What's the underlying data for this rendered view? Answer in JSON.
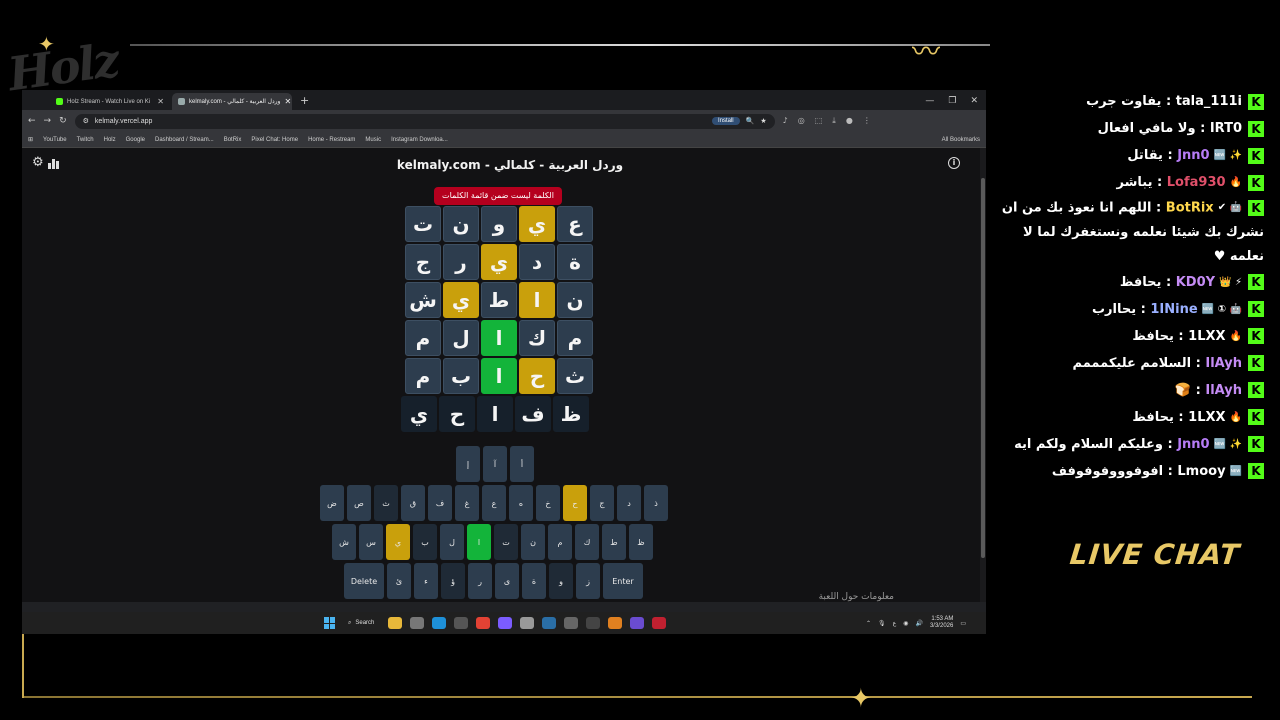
{
  "browser": {
    "tabs": [
      {
        "label": "Holz Stream - Watch Live on Ki"
      },
      {
        "label": "kelmaly.com - وردل العربية - كلمالي"
      }
    ],
    "url": "kelmaly.vercel.app",
    "install_label": "Install",
    "bookmarks": [
      "YouTube",
      "Twitch",
      "Holz",
      "Google",
      "Dashboard / Stream...",
      "BotRix",
      "Pixel Chat: Home",
      "Home - Restream",
      "Music",
      "Instagram Downloa..."
    ],
    "all_bookmarks": "All Bookmarks"
  },
  "game": {
    "title": "kelmaly.com - وردل العربية - كلمالي",
    "toast": "الكلمة ليست ضمن قائمة الكلمات",
    "board": [
      [
        {
          "l": "ت",
          "s": ""
        },
        {
          "l": "ن",
          "s": ""
        },
        {
          "l": "و",
          "s": ""
        },
        {
          "l": "ي",
          "s": "y"
        },
        {
          "l": "ع",
          "s": ""
        }
      ],
      [
        {
          "l": "ج",
          "s": ""
        },
        {
          "l": "ر",
          "s": ""
        },
        {
          "l": "ي",
          "s": "y"
        },
        {
          "l": "د",
          "s": ""
        },
        {
          "l": "ة",
          "s": ""
        }
      ],
      [
        {
          "l": "ش",
          "s": ""
        },
        {
          "l": "ي",
          "s": "y"
        },
        {
          "l": "ط",
          "s": ""
        },
        {
          "l": "ا",
          "s": "y"
        },
        {
          "l": "ن",
          "s": ""
        }
      ],
      [
        {
          "l": "م",
          "s": ""
        },
        {
          "l": "ل",
          "s": ""
        },
        {
          "l": "ا",
          "s": "g"
        },
        {
          "l": "ك",
          "s": ""
        },
        {
          "l": "م",
          "s": ""
        }
      ],
      [
        {
          "l": "م",
          "s": ""
        },
        {
          "l": "ب",
          "s": ""
        },
        {
          "l": "ا",
          "s": "g"
        },
        {
          "l": "ح",
          "s": "y"
        },
        {
          "l": "ث",
          "s": ""
        }
      ],
      [
        {
          "l": "ي",
          "s": "e"
        },
        {
          "l": "ح",
          "s": "e"
        },
        {
          "l": "ا",
          "s": "e"
        },
        {
          "l": "ف",
          "s": "e"
        },
        {
          "l": "ظ",
          "s": "e"
        }
      ]
    ],
    "keyboard": [
      [
        {
          "l": "إ",
          "s": ""
        },
        {
          "l": "آ",
          "s": ""
        },
        {
          "l": "أ",
          "s": ""
        }
      ],
      [
        {
          "l": "ض",
          "s": ""
        },
        {
          "l": "ص",
          "s": ""
        },
        {
          "l": "ث",
          "s": "d"
        },
        {
          "l": "ق",
          "s": ""
        },
        {
          "l": "ف",
          "s": ""
        },
        {
          "l": "غ",
          "s": ""
        },
        {
          "l": "ع",
          "s": ""
        },
        {
          "l": "ه",
          "s": ""
        },
        {
          "l": "خ",
          "s": ""
        },
        {
          "l": "ح",
          "s": "y"
        },
        {
          "l": "ج",
          "s": ""
        },
        {
          "l": "د",
          "s": ""
        },
        {
          "l": "ذ",
          "s": ""
        }
      ],
      [
        {
          "l": "ش",
          "s": ""
        },
        {
          "l": "س",
          "s": ""
        },
        {
          "l": "ي",
          "s": "y"
        },
        {
          "l": "ب",
          "s": "d"
        },
        {
          "l": "ل",
          "s": ""
        },
        {
          "l": "ا",
          "s": "g"
        },
        {
          "l": "ت",
          "s": "d"
        },
        {
          "l": "ن",
          "s": ""
        },
        {
          "l": "م",
          "s": ""
        },
        {
          "l": "ك",
          "s": ""
        },
        {
          "l": "ط",
          "s": ""
        },
        {
          "l": "ظ",
          "s": ""
        }
      ],
      [
        {
          "l": "Delete",
          "s": "w"
        },
        {
          "l": "ئ",
          "s": ""
        },
        {
          "l": "ء",
          "s": ""
        },
        {
          "l": "ؤ",
          "s": "d"
        },
        {
          "l": "ر",
          "s": ""
        },
        {
          "l": "ى",
          "s": ""
        },
        {
          "l": "ة",
          "s": ""
        },
        {
          "l": "و",
          "s": "d"
        },
        {
          "l": "ز",
          "s": ""
        },
        {
          "l": "Enter",
          "s": "w"
        }
      ]
    ],
    "howto": "معلومات حول اللعبة"
  },
  "taskbar": {
    "search": "Search",
    "time": "1:53 AM",
    "date": "3/3/2026",
    "lang": "ع"
  },
  "chat": {
    "messages": [
      {
        "user": "tala_111i",
        "text": "يفاوت جرب",
        "color": "#ffffff"
      },
      {
        "user": "IRT0",
        "text": "ولا مافي افعال",
        "color": "#ffffff"
      },
      {
        "user": "Jnn0",
        "text": "يقاتل",
        "color": "#b67cf5"
      },
      {
        "user": "Lofa930",
        "text": "يباشر",
        "color": "#e0506a"
      },
      {
        "user": "BotRix",
        "text": "اللهم انا نعوذ بك من ان نشرك بك شيئا نعلمه ونستغفرك لما لا نعلمه ♥",
        "color": "#ffd84d"
      },
      {
        "user": "KD0Y",
        "text": "يحافظ",
        "color": "#c58cf5"
      },
      {
        "user": "1INine",
        "text": "يحاارب",
        "color": "#9ab0ff"
      },
      {
        "user": "1LXX",
        "text": "يحافظ",
        "color": "#ffffff"
      },
      {
        "user": "IlAyh",
        "text": "السلامم عليكمممم",
        "color": "#c58cf5"
      },
      {
        "user": "IlAyh",
        "text": "",
        "color": "#c58cf5"
      },
      {
        "user": "1LXX",
        "text": "يحافظ",
        "color": "#ffffff"
      },
      {
        "user": "Jnn0",
        "text": "وعليكم السلام ولكم ايه",
        "color": "#b67cf5"
      },
      {
        "user": "Lmooy",
        "text": "افوفوووفوفوفف",
        "color": "#ffffff"
      }
    ],
    "title": "LIVE CHAT"
  }
}
